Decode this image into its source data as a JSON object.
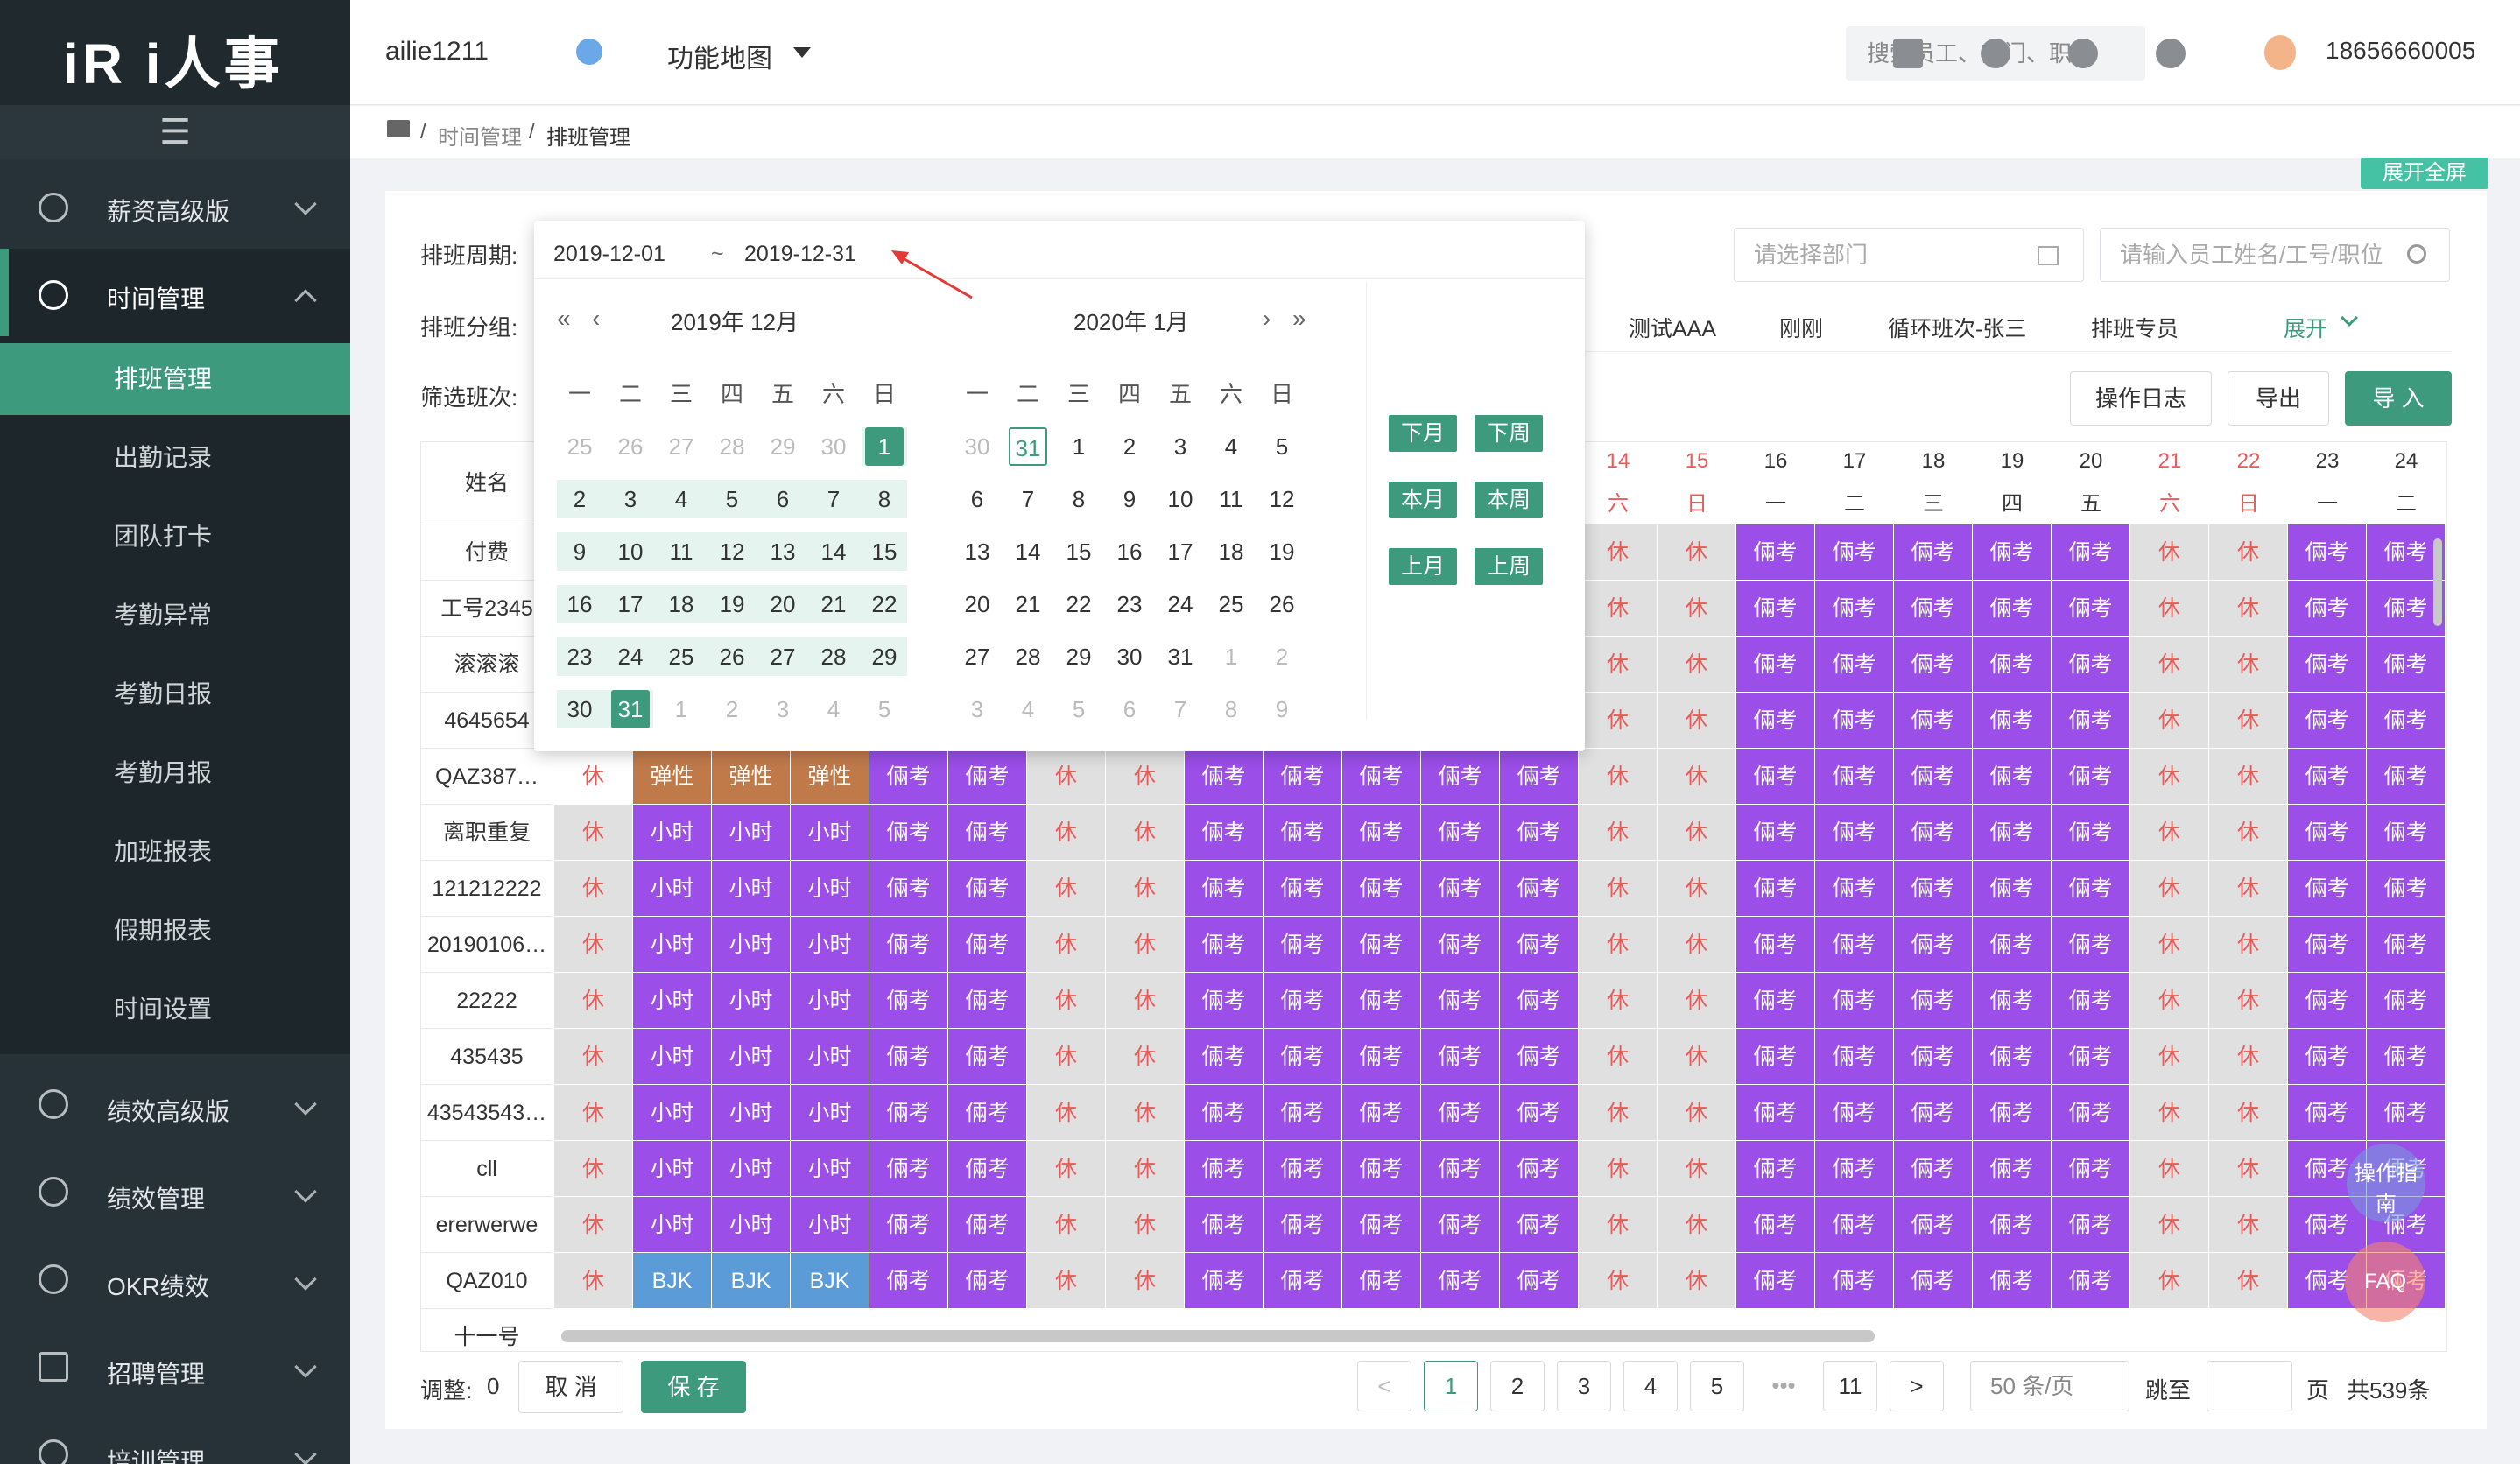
{
  "logo": "iR i人事",
  "sidebar": {
    "groups": [
      {
        "label": "薪资高级版"
      },
      {
        "label": "时间管理"
      },
      {
        "label": "绩效高级版"
      },
      {
        "label": "绩效管理"
      },
      {
        "label": "OKR绩效"
      },
      {
        "label": "招聘管理"
      },
      {
        "label": "培训管理"
      }
    ],
    "sub": [
      "排班管理",
      "出勤记录",
      "团队打卡",
      "考勤异常",
      "考勤日报",
      "考勤月报",
      "加班报表",
      "假期报表",
      "时间设置"
    ]
  },
  "header": {
    "company": "ailie1211",
    "map": "功能地图",
    "search_placeholder": "搜索员工、部门、职位",
    "phone": "18656660005"
  },
  "breadcrumb": {
    "sep": "/",
    "parent": "时间管理",
    "current": "排班管理"
  },
  "fullscreen": "展开全屏",
  "filters": {
    "period_label": "排班周期:",
    "start": "2019-12-01",
    "tilde": "~",
    "end": "2019-12-31",
    "group_label": "排班分组:",
    "shift_label": "筛选班次:",
    "dept_placeholder": "请选择部门",
    "emp_placeholder": "请输入员工姓名/工号/职位",
    "tabs": [
      "测试AAA",
      "刚刚",
      "循环班次-张三",
      "排班专员"
    ],
    "expand": "展开",
    "log_btn": "操作日志",
    "export_btn": "导出",
    "import_btn": "导 入"
  },
  "calendar": {
    "left_title": "2019年 12月",
    "right_title": "2020年 1月",
    "weekdays": [
      "一",
      "二",
      "三",
      "四",
      "五",
      "六",
      "日"
    ],
    "left_days": [
      [
        25,
        26,
        27,
        28,
        29,
        30,
        1
      ],
      [
        2,
        3,
        4,
        5,
        6,
        7,
        8
      ],
      [
        9,
        10,
        11,
        12,
        13,
        14,
        15
      ],
      [
        16,
        17,
        18,
        19,
        20,
        21,
        22
      ],
      [
        23,
        24,
        25,
        26,
        27,
        28,
        29
      ],
      [
        30,
        31,
        1,
        2,
        3,
        4,
        5
      ]
    ],
    "right_days": [
      [
        30,
        31,
        1,
        2,
        3,
        4,
        5
      ],
      [
        6,
        7,
        8,
        9,
        10,
        11,
        12
      ],
      [
        13,
        14,
        15,
        16,
        17,
        18,
        19
      ],
      [
        20,
        21,
        22,
        23,
        24,
        25,
        26
      ],
      [
        27,
        28,
        29,
        30,
        31,
        1,
        2
      ],
      [
        3,
        4,
        5,
        6,
        7,
        8,
        9
      ]
    ],
    "quick": [
      "下月",
      "下周",
      "本月",
      "本周",
      "上月",
      "上周"
    ]
  },
  "table": {
    "name_header": "姓名",
    "days": [
      {
        "d": "14",
        "w": "六"
      },
      {
        "d": "15",
        "w": "日"
      },
      {
        "d": "16",
        "w": "一"
      },
      {
        "d": "17",
        "w": "二"
      },
      {
        "d": "18",
        "w": "三"
      },
      {
        "d": "19",
        "w": "四"
      },
      {
        "d": "20",
        "w": "五"
      },
      {
        "d": "21",
        "w": "六"
      },
      {
        "d": "22",
        "w": "日"
      },
      {
        "d": "23",
        "w": "一"
      },
      {
        "d": "24",
        "w": "二"
      }
    ],
    "rows": [
      "付费",
      "工号2345",
      "滚滚滚",
      "4645654",
      "QAZ387…",
      "离职重复",
      "121212222",
      "20190106…",
      "22222",
      "435435",
      "43543543…",
      "cll",
      "ererwerwe",
      "QAZ010",
      "十一号"
    ],
    "labels": {
      "rest": "休",
      "p": "倆考",
      "flex": "弹性",
      "hour": "小时",
      "bjk": "BJK"
    }
  },
  "footer": {
    "adjust": "调整:",
    "adjust_n": "0",
    "cancel": "取 消",
    "save": "保 存",
    "pages": [
      "1",
      "2",
      "3",
      "4",
      "5",
      "•••",
      "11"
    ],
    "prev": "<",
    "next": ">",
    "pagesize": "50 条/页",
    "goto": "跳至",
    "page_unit": "页",
    "total": "共539条"
  },
  "float": {
    "guide": "操作指南",
    "faq": "FAQ"
  }
}
